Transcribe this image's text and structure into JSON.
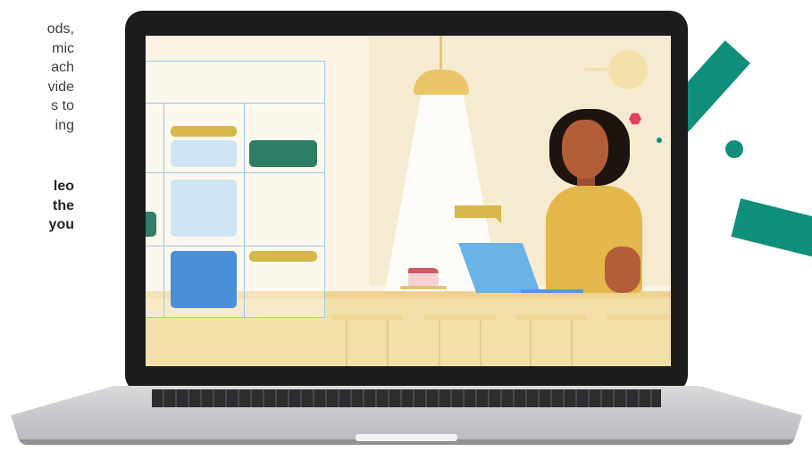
{
  "left_text": {
    "lines": [
      "ods,",
      "mic",
      "ach",
      "vide",
      "s to",
      "ing"
    ],
    "bold_lines": [
      "leo",
      "the",
      "you"
    ]
  },
  "colors": {
    "accent_teal": "#0f8f7a",
    "accent_red": "#e0405b",
    "lamp_gold": "#e9c66a",
    "calendar_blue": "#9cc7e3",
    "event_blue": "#4a90d9",
    "event_green": "#2f7d66",
    "event_gold": "#d7b64a",
    "shirt": "#e3b84a",
    "laptop_screen": "#6ab3e6"
  }
}
